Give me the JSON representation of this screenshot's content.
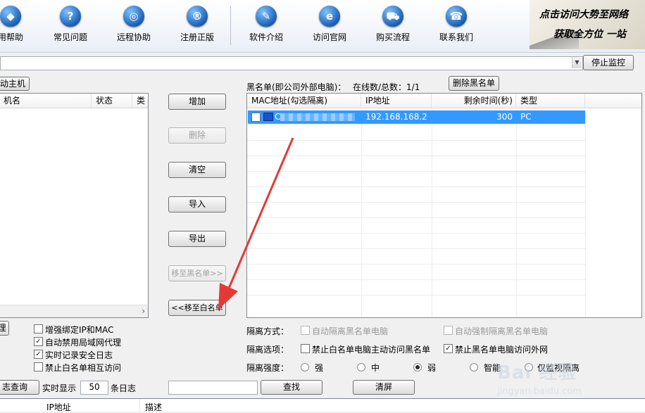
{
  "toolbar": {
    "items": [
      {
        "label": "用帮助",
        "icon": "graduation-cap-icon",
        "glyph": "◆"
      },
      {
        "label": "常见问题",
        "icon": "question-icon",
        "glyph": "?"
      },
      {
        "label": "远程协助",
        "icon": "globe-hand-icon",
        "glyph": "◎"
      },
      {
        "label": "注册正版",
        "icon": "registered-icon",
        "glyph": "®"
      },
      {
        "label": "软件介绍",
        "icon": "document-pen-icon",
        "glyph": "✎"
      },
      {
        "label": "访问官网",
        "icon": "ie-browser-icon",
        "glyph": "e"
      },
      {
        "label": "购买流程",
        "icon": "shopping-cart-icon",
        "glyph": "⛟"
      },
      {
        "label": "联系我们",
        "icon": "telephone-icon",
        "glyph": "☎"
      }
    ],
    "banner_line1": "点击访问大势至网络",
    "banner_line2": "获取全方位 一站"
  },
  "stop_monitor_label": "停止监控",
  "left_panel": {
    "host_button_label": "动主机",
    "columns": [
      "机名",
      "状态",
      "类"
    ],
    "scroll_arrow": "›"
  },
  "mid_buttons": {
    "add": "增加",
    "delete": "删除",
    "clear": "清空",
    "import": "导入",
    "export": "导出",
    "move_to_black": "移至黑名单>>",
    "move_to_white": "<<移至白名单"
  },
  "blacklist": {
    "title": "黑名单(即公司外部电脑)：",
    "online_label": "在线数/总数：1/1",
    "delete_button": "删除黑名单",
    "columns": [
      "MAC地址(勾选隔离)",
      "IP地址",
      "剩余时间(秒)",
      "类型"
    ],
    "rows": [
      {
        "mac": "C",
        "ip": "192.168.168.2",
        "remaining": "300",
        "type": "PC"
      }
    ]
  },
  "left_options": {
    "partial_button": "理",
    "items": [
      {
        "label": "增强绑定IP和MAC",
        "checked": false
      },
      {
        "label": "自动禁用局域网代理",
        "checked": true
      },
      {
        "label": "实时记录安全日志",
        "checked": true
      },
      {
        "label": "禁止白名单相互访问",
        "checked": false
      }
    ]
  },
  "isolation": {
    "mode_label": "隔离方式：",
    "mode_opt1": "自动隔离黑名单电脑",
    "mode_opt2": "自动强制隔离黑名单电脑",
    "option_label": "隔离选项：",
    "option_opt1": "禁止白名单电脑主动访问黑名单",
    "option_opt2": "禁止黑名单电脑访问外网",
    "strength_label": "隔离强度：",
    "strength": [
      "强",
      "中",
      "弱",
      "智能",
      "仅监视隔离"
    ],
    "strength_selected": "弱"
  },
  "log_bar": {
    "query_button": "志查询",
    "realtime_label": "实时显示",
    "count": "50",
    "suffix": "条日志",
    "search_button": "查找",
    "clear_button": "清屏"
  },
  "bottom_table": {
    "columns": [
      "IP地址",
      "描述"
    ]
  },
  "watermark": {
    "brand": "Bai 经验",
    "url": "jingyan.baidu.com"
  },
  "colors": {
    "selection": "#3399ff",
    "arrow": "#e53935"
  }
}
